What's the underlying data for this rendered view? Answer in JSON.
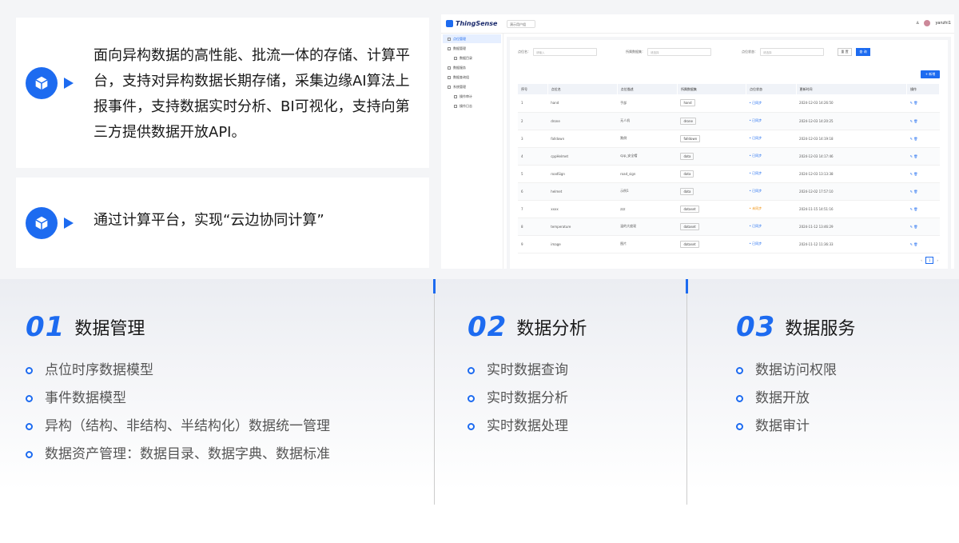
{
  "cards": [
    {
      "text": "面向异构数据的高性能、批流一体的存储、计算平台，支持对异构数据长期存储，采集边缘AI算法上报事件，支持数据实时分析、BI可视化，支持向第三方提供数据开放API。"
    },
    {
      "text": "通过计算平台，实现“云边协同计算”"
    }
  ],
  "app": {
    "logo": "ThingSense",
    "tenant": "演示用户组",
    "user": "yanzhi1",
    "sidebar": [
      "点位管理",
      "数据管理",
      "数据目录",
      "数据服务",
      "数据查询组",
      "系统管理",
      "操作审计",
      "操作日志"
    ],
    "filters": [
      "点位名：",
      "所属数据集：",
      "点位状态："
    ],
    "filter_placeholders": [
      "请输入",
      "请选择",
      "请选择"
    ],
    "reset": "重 置",
    "query": "查 询",
    "add": "+ 新增",
    "columns": [
      "序号",
      "点位名",
      "点位描述",
      "所属数据集",
      "点位状态",
      "更新时间",
      "操作"
    ],
    "rows": [
      {
        "no": "1",
        "name": "hand",
        "desc": "手部",
        "dataset": "hand",
        "status": "已同步",
        "time": "2024-12-03 14:26:50"
      },
      {
        "no": "2",
        "name": "drone",
        "desc": "无人机",
        "dataset": "drone",
        "status": "已同步",
        "time": "2024-12-03 14:20:25"
      },
      {
        "no": "3",
        "name": "falldown",
        "desc": "跌倒",
        "dataset": "falldown",
        "status": "已同步",
        "time": "2024-12-03 14:19:18"
      },
      {
        "no": "4",
        "name": "cppHelmet",
        "desc": "cpp_安全帽",
        "dataset": "data",
        "status": "已同步",
        "time": "2024-12-03 14:17:46"
      },
      {
        "no": "5",
        "name": "roadSign",
        "desc": "road_sign",
        "dataset": "data",
        "status": "已同步",
        "time": "2024-12-03 13:13:38"
      },
      {
        "no": "6",
        "name": "helmet",
        "desc": "示例1",
        "dataset": "data",
        "status": "已同步",
        "time": "2024-12-02 17:57:10"
      },
      {
        "no": "7",
        "name": "xxxx",
        "desc": "zzz",
        "dataset": "dataset",
        "status": "未同步",
        "time": "2024-11-15 14:51:16"
      },
      {
        "no": "8",
        "name": "temperature",
        "desc": "温的大度现",
        "dataset": "dataset",
        "status": "已同步",
        "time": "2024-11-12 13:46:29"
      },
      {
        "no": "9",
        "name": "image",
        "desc": "图片",
        "dataset": "dataset",
        "status": "已同步",
        "time": "2024-11-12 11:36:33"
      }
    ],
    "page": "1"
  },
  "sections": [
    {
      "num": "01",
      "title": "数据管理",
      "items": [
        "点位时序数据模型",
        "事件数据模型",
        "异构（结构、非结构、半结构化）数据统一管理",
        "数据资产管理：数据目录、数据字典、数据标准"
      ]
    },
    {
      "num": "02",
      "title": "数据分析",
      "items": [
        "实时数据查询",
        "实时数据分析",
        "实时数据处理"
      ]
    },
    {
      "num": "03",
      "title": "数据服务",
      "items": [
        "数据访问权限",
        "数据开放",
        "数据审计"
      ]
    }
  ],
  "colors": {
    "accent": "#1d6bf0"
  }
}
